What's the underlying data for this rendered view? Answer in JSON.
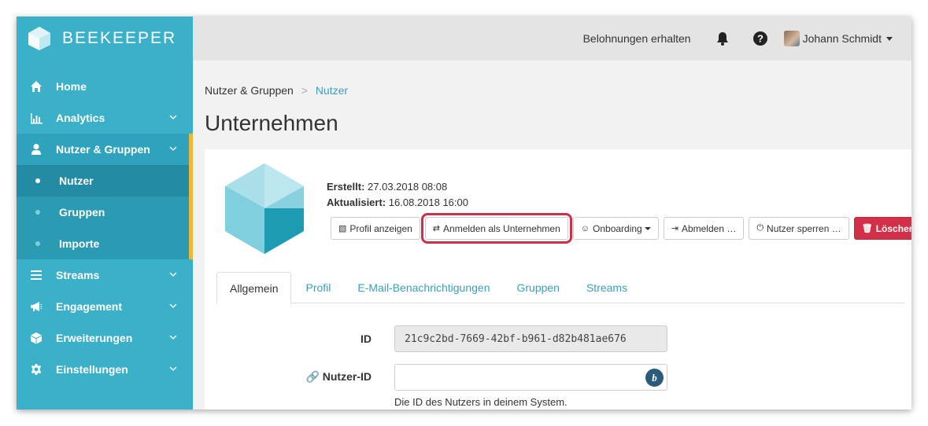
{
  "app": {
    "brand": "BEEKEEPER"
  },
  "colors": {
    "sidebar": "#3bb0c9",
    "accent": "#f5b731",
    "link": "#3a9fb8",
    "danger": "#d32f48",
    "highlight": "#c9304a"
  },
  "sidebar": {
    "items": [
      {
        "label": "Home",
        "icon": "home-icon"
      },
      {
        "label": "Analytics",
        "icon": "bar-chart-icon"
      },
      {
        "label": "Nutzer & Gruppen",
        "icon": "user-icon"
      },
      {
        "label": "Nutzer"
      },
      {
        "label": "Gruppen"
      },
      {
        "label": "Importe"
      },
      {
        "label": "Streams",
        "icon": "menu-icon"
      },
      {
        "label": "Engagement",
        "icon": "megaphone-icon"
      },
      {
        "label": "Erweiterungen",
        "icon": "cube-icon"
      },
      {
        "label": "Einstellungen",
        "icon": "gear-icon"
      }
    ]
  },
  "header": {
    "rewards": "Belohnungen erhalten",
    "user_name": "Johann Schmidt"
  },
  "breadcrumb": {
    "parent": "Nutzer & Gruppen",
    "sep": ">",
    "current": "Nutzer"
  },
  "page": {
    "title": "Unternehmen"
  },
  "profile": {
    "created_label": "Erstellt:",
    "created_value": "27.03.2018 08:08",
    "updated_label": "Aktualisiert:",
    "updated_value": "16.08.2018 16:00"
  },
  "actions": {
    "view_profile": "Profil anzeigen",
    "login_as": "Anmelden als Unternehmen",
    "onboarding": "Onboarding",
    "logout": "Abmelden …",
    "block": "Nutzer sperren …",
    "delete": "Löschen …"
  },
  "tabs": [
    "Allgemein",
    "Profil",
    "E-Mail-Benachrichtigungen",
    "Gruppen",
    "Streams"
  ],
  "form": {
    "id_label": "ID",
    "id_value": "21c9c2bd-7669-42bf-b961-d82b481ae676",
    "user_id_label": "Nutzer-ID",
    "user_id_value": "",
    "user_id_badge": "b",
    "user_id_help": "Die ID des Nutzers in deinem System."
  }
}
